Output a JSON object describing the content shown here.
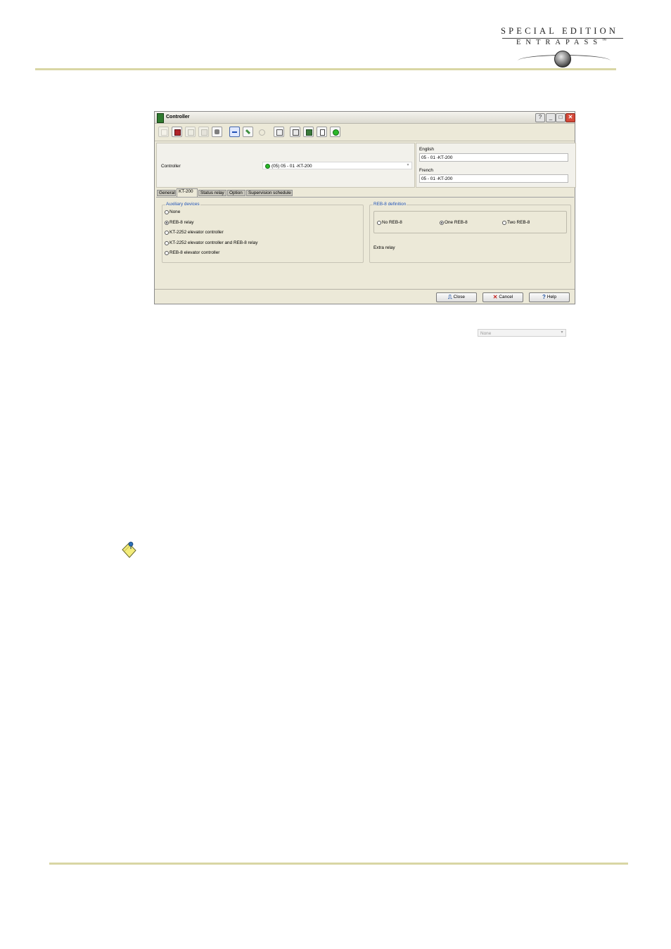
{
  "brand": {
    "line1": "SPECIAL EDITION",
    "line2": "ENTRAPASS",
    "trademark": "™"
  },
  "window": {
    "title": "Controller",
    "controls": {
      "help": "?",
      "minimize": "_",
      "maximize": "□",
      "close": "✕"
    },
    "toolbar": [
      "new-icon",
      "save-icon",
      "copy-icon",
      "delete-icon",
      "print-icon",
      "link-icon",
      "edit-icon",
      "search-icon",
      "refresh-icon",
      "door-icon",
      "grid-icon",
      "card-icon",
      "status-icon"
    ],
    "header": {
      "controller_label": "Controller",
      "controller_value": "(05) 05 - 01 -KT-200",
      "english_label": "English",
      "english_value": "05 - 01 -KT-200",
      "french_label": "French",
      "french_value": "05 - 01 -KT-200"
    },
    "tabs": [
      {
        "label": "General",
        "active": false
      },
      {
        "label": "KT-200",
        "active": true
      },
      {
        "label": "Status relay",
        "active": false
      },
      {
        "label": "Option",
        "active": false
      },
      {
        "label": "Supervision schedule",
        "active": false
      }
    ],
    "aux": {
      "title": "Auxiliary devices",
      "options": [
        {
          "label": "None",
          "selected": false
        },
        {
          "label": "REB-8 relay",
          "selected": true
        },
        {
          "label": "KT-2252 elevator controller",
          "selected": false
        },
        {
          "label": "KT-2252 elevator controller and REB-8 relay",
          "selected": false
        },
        {
          "label": "REB-8 elevator controller",
          "selected": false
        }
      ]
    },
    "reb": {
      "title": "REB-8 definition",
      "options": [
        {
          "label": "No REB-8",
          "selected": false
        },
        {
          "label": "One REB-8",
          "selected": true
        },
        {
          "label": "Two REB-8",
          "selected": false
        }
      ],
      "extra_relay_label": "Extra relay",
      "extra_relay_value": "None"
    },
    "footer": {
      "close_label": "Close",
      "cancel_label": "Cancel",
      "help_label": "Help"
    }
  },
  "colors": {
    "accent_rule": "#d9d6a4",
    "group_title": "#2154b8",
    "status_dot": "#28b828"
  }
}
